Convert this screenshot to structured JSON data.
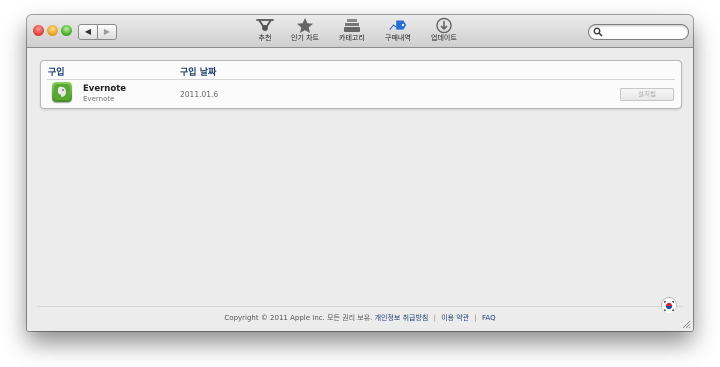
{
  "toolbar": {
    "items": [
      {
        "label": "추천",
        "icon": "featured-icon"
      },
      {
        "label": "인기 차트",
        "icon": "star-icon"
      },
      {
        "label": "카테고리",
        "icon": "categories-icon"
      },
      {
        "label": "구매내역",
        "icon": "purchases-tag-icon"
      },
      {
        "label": "업데이트",
        "icon": "updates-icon"
      }
    ],
    "back_glyph": "◀",
    "forward_glyph": "▶",
    "search_placeholder": ""
  },
  "purchases": {
    "col_purchase": "구입",
    "col_date": "구입 날짜",
    "items": [
      {
        "name": "Evernote",
        "developer": "Evernote",
        "date": "2011.01.6",
        "button": "설치됨"
      }
    ]
  },
  "footer": {
    "copyright": "Copyright © 2011 Apple Inc. 모든 권리 보유.",
    "privacy": "개인정보 취급방침",
    "terms": "이용 약관",
    "faq": "FAQ",
    "separator": "|"
  },
  "colors": {
    "accent": "#1f3e70",
    "selected_tab": "#2a6fd6",
    "evernote_green": "#4fa42d"
  }
}
